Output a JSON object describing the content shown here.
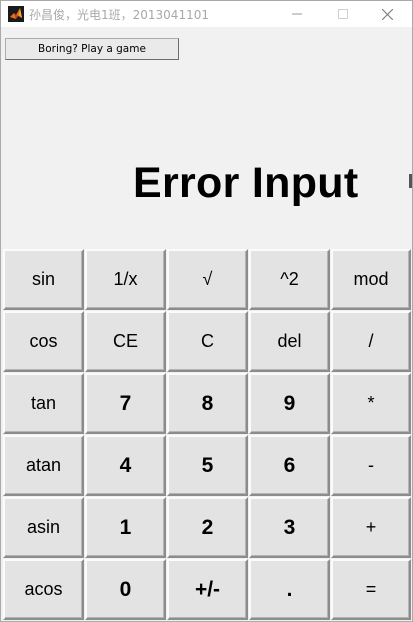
{
  "window": {
    "title": "孙昌俊，光电1班，2013041101"
  },
  "game_button_label": "Boring? Play a game",
  "display": {
    "text": "Error Input"
  },
  "keypad": {
    "rows": [
      [
        {
          "label": "sin",
          "name": "sin-key",
          "bold": false
        },
        {
          "label": "1/x",
          "name": "reciprocal-key",
          "bold": false
        },
        {
          "label": "√",
          "name": "sqrt-key",
          "bold": false
        },
        {
          "label": "^2",
          "name": "square-key",
          "bold": false
        },
        {
          "label": "mod",
          "name": "mod-key",
          "bold": false
        }
      ],
      [
        {
          "label": "cos",
          "name": "cos-key",
          "bold": false
        },
        {
          "label": "CE",
          "name": "clear-entry-key",
          "bold": false
        },
        {
          "label": "C",
          "name": "clear-key",
          "bold": false
        },
        {
          "label": "del",
          "name": "delete-key",
          "bold": false
        },
        {
          "label": "/",
          "name": "divide-key",
          "bold": false
        }
      ],
      [
        {
          "label": "tan",
          "name": "tan-key",
          "bold": false
        },
        {
          "label": "7",
          "name": "digit-7-key",
          "bold": true
        },
        {
          "label": "8",
          "name": "digit-8-key",
          "bold": true
        },
        {
          "label": "9",
          "name": "digit-9-key",
          "bold": true
        },
        {
          "label": "*",
          "name": "multiply-key",
          "bold": false
        }
      ],
      [
        {
          "label": "atan",
          "name": "atan-key",
          "bold": false
        },
        {
          "label": "4",
          "name": "digit-4-key",
          "bold": true
        },
        {
          "label": "5",
          "name": "digit-5-key",
          "bold": true
        },
        {
          "label": "6",
          "name": "digit-6-key",
          "bold": true
        },
        {
          "label": "-",
          "name": "subtract-key",
          "bold": false
        }
      ],
      [
        {
          "label": "asin",
          "name": "asin-key",
          "bold": false
        },
        {
          "label": "1",
          "name": "digit-1-key",
          "bold": true
        },
        {
          "label": "2",
          "name": "digit-2-key",
          "bold": true
        },
        {
          "label": "3",
          "name": "digit-3-key",
          "bold": true
        },
        {
          "label": "+",
          "name": "add-key",
          "bold": false
        }
      ],
      [
        {
          "label": "acos",
          "name": "acos-key",
          "bold": false
        },
        {
          "label": "0",
          "name": "digit-0-key",
          "bold": true
        },
        {
          "label": "+/-",
          "name": "negate-key",
          "bold": true
        },
        {
          "label": ".",
          "name": "decimal-key",
          "bold": true
        },
        {
          "label": "=",
          "name": "equals-key",
          "bold": false
        }
      ]
    ]
  }
}
